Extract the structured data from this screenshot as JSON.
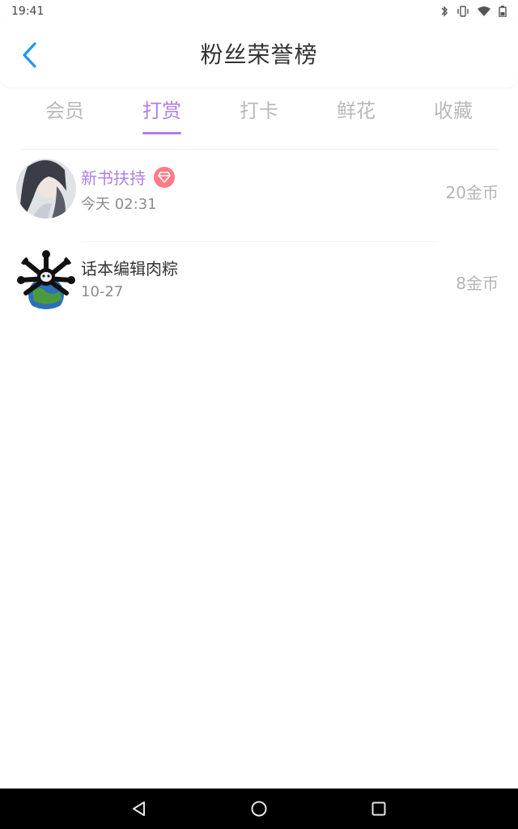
{
  "status_bar": {
    "time": "19:41",
    "icons": [
      "bluetooth-icon",
      "vibrate-icon",
      "wifi-icon",
      "battery-icon"
    ]
  },
  "header": {
    "back_icon": "chevron-left-icon",
    "title": "粉丝荣誉榜"
  },
  "tabs": [
    {
      "label": "会员",
      "active": false
    },
    {
      "label": "打赏",
      "active": true
    },
    {
      "label": "打卡",
      "active": false
    },
    {
      "label": "鲜花",
      "active": false
    },
    {
      "label": "收藏",
      "active": false
    }
  ],
  "colors": {
    "accent": "#b07fe6",
    "badge": "#ff7b88",
    "tab_inactive": "#b9b9bd"
  },
  "entries": [
    {
      "name": "新书扶持",
      "has_vip_badge": true,
      "time": "今天 02:31",
      "amount": "20金币"
    },
    {
      "name": "话本编辑肉粽",
      "has_vip_badge": false,
      "time": "10-27",
      "amount": "8金币"
    }
  ],
  "nav_bar": {
    "back": "triangle-back-icon",
    "home": "circle-home-icon",
    "recents": "square-recents-icon"
  }
}
